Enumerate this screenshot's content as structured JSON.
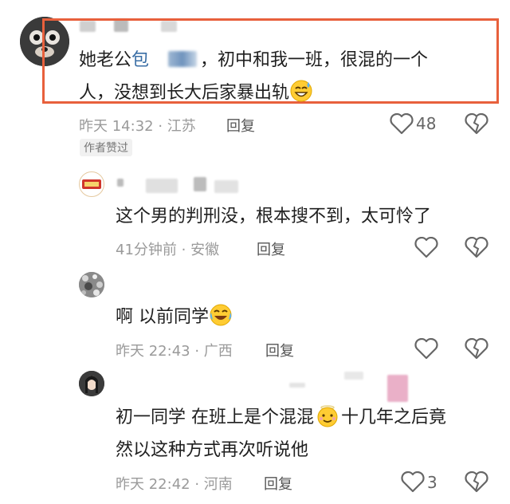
{
  "comments": [
    {
      "line1_prefix": "她老公",
      "line1_name": "包",
      "line1_rest": "，初中和我一班，很混的一个",
      "line2": "人，没想到长大后家暴出轨",
      "meta": "昨天 14:32 · 江苏",
      "reply_label": "回复",
      "likes": "48",
      "tag": "作者赞过",
      "emoji": "sweat-smile-icon"
    },
    {
      "text": "这个男的判刑没，根本搜不到，太可怜了",
      "meta": "41分钟前 · 安徽",
      "reply_label": "回复"
    },
    {
      "text": "啊 以前同学",
      "meta": "昨天 22:43 · 广西",
      "reply_label": "回复",
      "emoji": "crying-laughing-icon"
    },
    {
      "line1_prefix": "初一同学 在班上是个混混",
      "line1_suffix": "十几年之后竟",
      "line2": "然以这种方式再次听说他",
      "meta": "昨天 22:42 · 河南",
      "reply_label": "回复",
      "likes": "3",
      "emoji": "innocent-smile-icon"
    }
  ],
  "colors": {
    "highlight": "#e8603c",
    "name_link": "#3a6ea5",
    "meta": "#9a9a9a"
  }
}
